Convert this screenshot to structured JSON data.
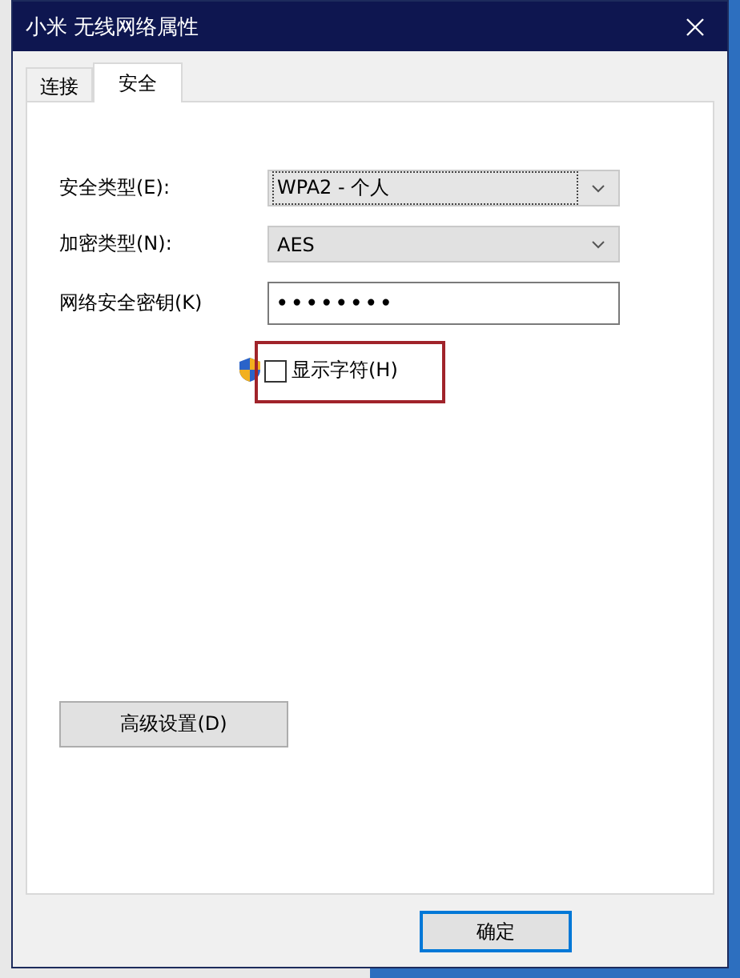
{
  "window": {
    "title": "小米 无线网络属性"
  },
  "tabs": [
    {
      "label": "连接",
      "selected": false
    },
    {
      "label": "安全",
      "selected": true
    }
  ],
  "fields": [
    {
      "kind": "dropdown",
      "label": "安全类型(E):",
      "value": "WPA2 - 个人",
      "focused": true
    },
    {
      "kind": "dropdown",
      "label": "加密类型(N):",
      "value": "AES",
      "focused": false
    },
    {
      "kind": "password",
      "label": "网络安全密钥(K)",
      "value": "••••••••",
      "focused": false
    }
  ],
  "show_characters": {
    "label": "显示字符(H)",
    "checked": false,
    "highlighted": true
  },
  "advanced_button": "高级设置(D)",
  "buttons": [
    "确定"
  ]
}
